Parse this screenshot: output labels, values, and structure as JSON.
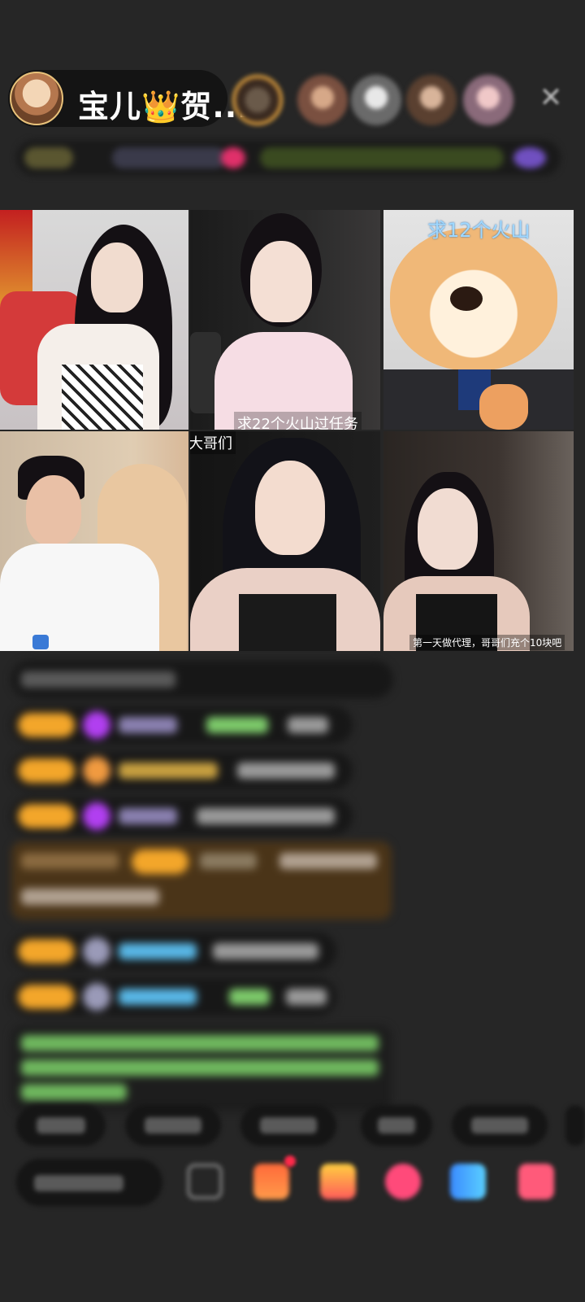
{
  "header": {
    "host_name": "宝儿👑贺...",
    "host_avatar_icon": "host-avatar",
    "close_icon": "close-icon",
    "close_glyph": "✕"
  },
  "video_grid": {
    "tiles": [
      {
        "caption": ""
      },
      {
        "caption": "求22个火山过任务"
      },
      {
        "caption": "求12个火山"
      },
      {
        "caption": "大哥们"
      },
      {
        "caption": ""
      },
      {
        "caption": "第一天做代理，哥哥们充个10块吧"
      }
    ]
  },
  "colors": {
    "background": "#262626",
    "badge": "#f3a62a",
    "gem_purple": "#b13ff0",
    "chat_green": "#7cc96a",
    "chat_blue": "#58b7e6"
  }
}
